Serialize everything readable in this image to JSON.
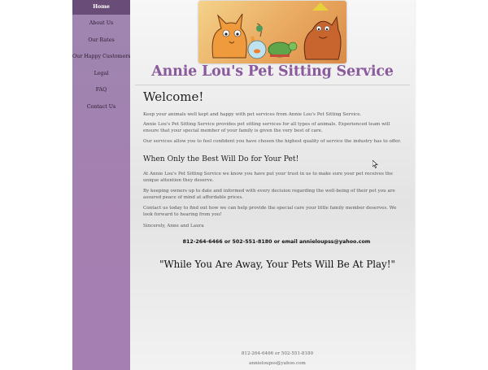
{
  "nav": {
    "items": [
      {
        "label": "Home"
      },
      {
        "label": "About Us"
      },
      {
        "label": "Our Rates"
      },
      {
        "label": "Our Happy Customers"
      },
      {
        "label": "Legal"
      },
      {
        "label": "FAQ"
      },
      {
        "label": "Contact Us"
      }
    ]
  },
  "header": {
    "title": "Annie Lou's Pet Sitting Service"
  },
  "content": {
    "welcome_heading": "Welcome!",
    "intro_paragraphs": [
      "Keep your animals well kept and happy with pet services from Annie Lou's Pet Sitting Service.",
      "Annie Lou's Pet Sitting Service provides pet sitting services for all types of animals. Experienced team will ensure that your special member of your family is given the very best of care.",
      "Our services allow you to feel confident you have chosen the highest quality of service the industry has to offer."
    ],
    "subheading": "When Only the Best Will Do for Your Pet!",
    "body_paragraphs": [
      "At Annie Lou's Pet Sitting Service we know you have put your trust in us to make sure your pet receives the unique attention they deserve.",
      "By keeping owners up to date and informed with every decision regarding the well-being of their pet you are assured peace of mind at affordable prices.",
      "Contact us today to find out how we can help provide the special care your little family member deserves. We look forward to hearing from you!",
      "Sincerely, Anne and Laura"
    ],
    "contact_line": "812-264-6466 or 502-551-8180 or email annieloupss@yahoo.com",
    "slogan": "\"While You Are Away, Your Pets Will Be At Play!\""
  },
  "footer": {
    "phone": "812-264-6466 or 502-551-8180",
    "email": "annieloupss@yahoo.com"
  },
  "colors": {
    "sidebar": "#a47fb0",
    "nav_active": "#6a4c78",
    "title": "#8a5a9c"
  },
  "icons": {
    "banner": "pets-illustration",
    "cursor": "mouse-pointer-icon"
  }
}
